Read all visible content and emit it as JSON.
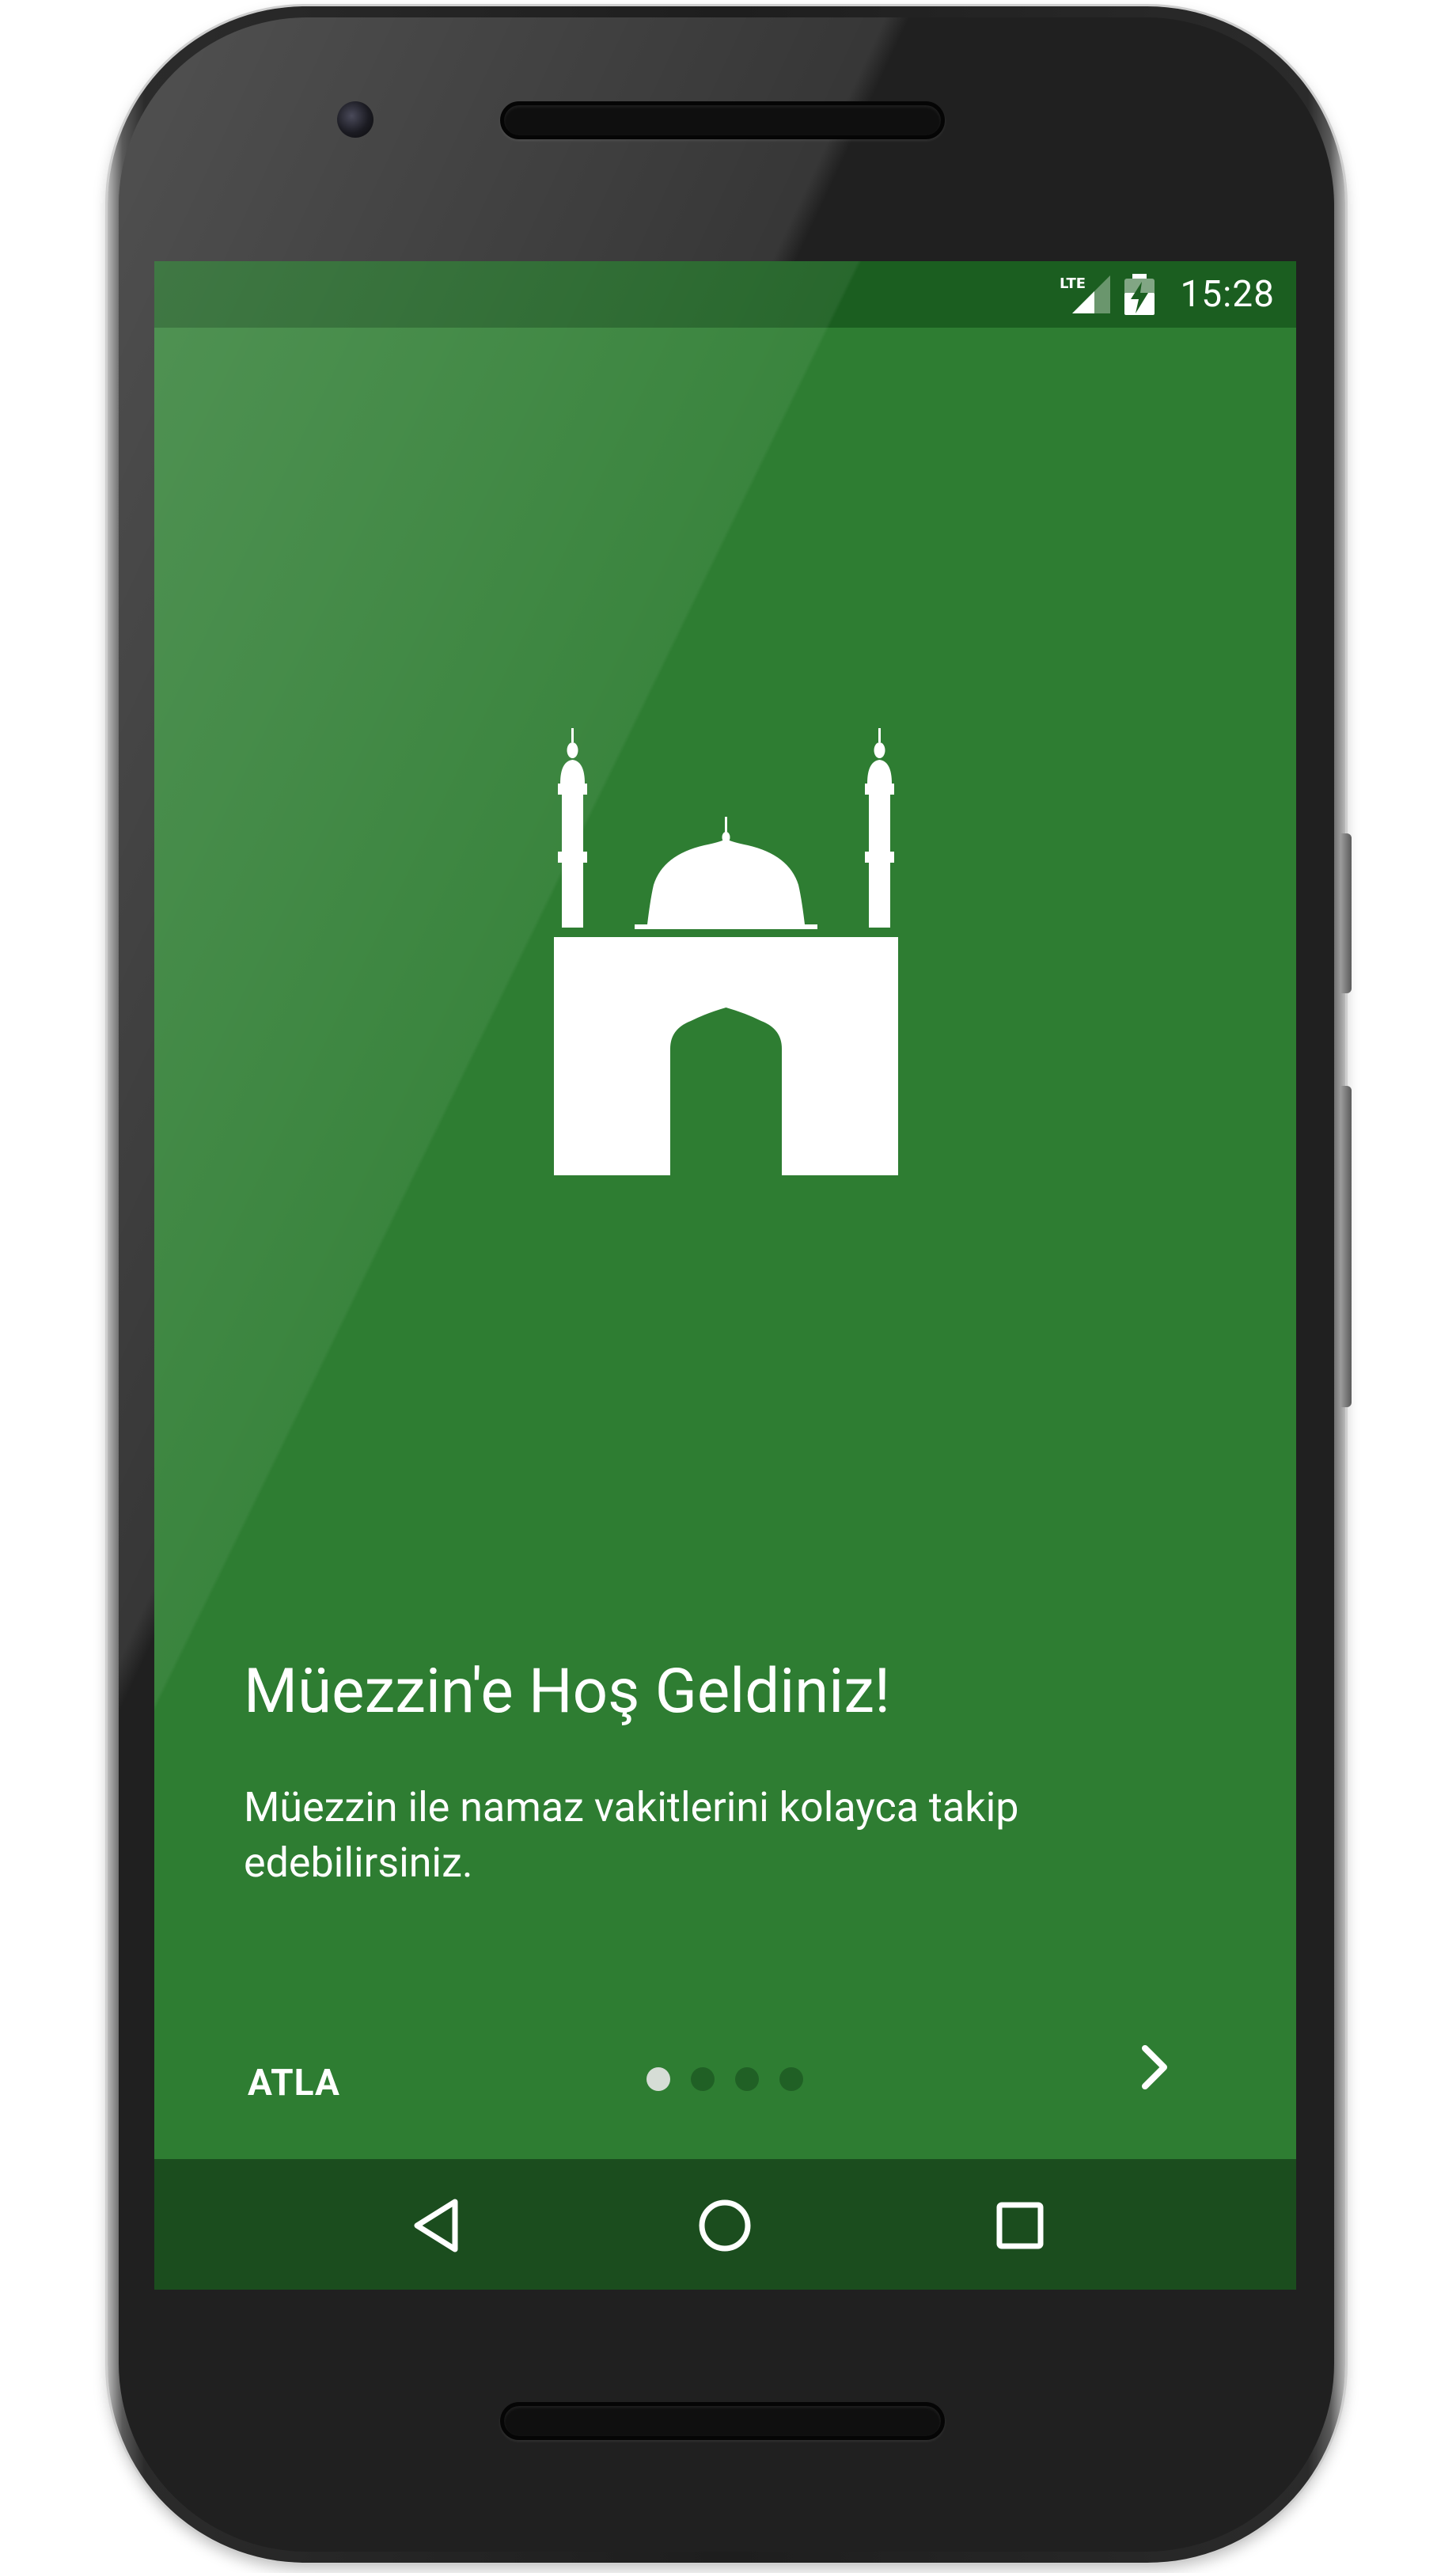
{
  "status_bar": {
    "time": "15:28",
    "network": "LTE",
    "icons": [
      "lte-signal-icon",
      "battery-charging-icon"
    ]
  },
  "intro": {
    "logo_icon": "mosque-icon",
    "title": "Müezzin'e Hoş Geldiniz!",
    "description": "Müezzin ile namaz vakitlerini kolayca takip edebilirsiniz.",
    "skip_label": "ATLA",
    "next_icon": "chevron-right-icon",
    "pager": {
      "total_pages": 4,
      "current_page": 1
    }
  },
  "navigation_bar": {
    "icons": [
      "back-icon",
      "home-icon",
      "recent-apps-icon"
    ]
  },
  "colors": {
    "primary": "#2e7d32",
    "status_bar": "#1b5e20",
    "navigation_bar": "#1b4d1e",
    "text": "#ffffff"
  }
}
